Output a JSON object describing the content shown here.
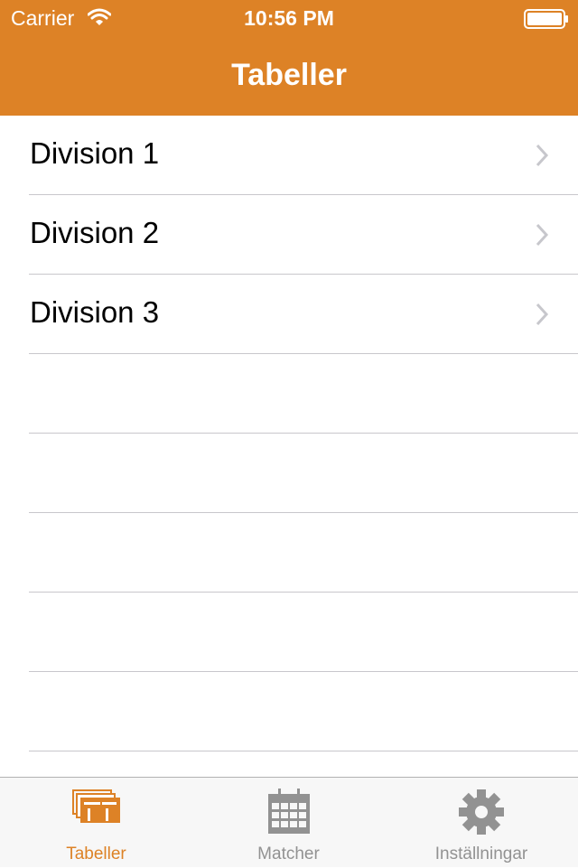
{
  "colors": {
    "accent": "#dd8226",
    "inactive": "#929292",
    "separator": "#c8c7cc"
  },
  "status_bar": {
    "carrier": "Carrier",
    "time": "10:56 PM",
    "wifi_icon": "wifi-icon",
    "battery_icon": "battery-icon"
  },
  "nav": {
    "title": "Tabeller"
  },
  "list": {
    "items": [
      {
        "label": "Division 1",
        "icon": "chevron-right-icon"
      },
      {
        "label": "Division 2",
        "icon": "chevron-right-icon"
      },
      {
        "label": "Division 3",
        "icon": "chevron-right-icon"
      }
    ]
  },
  "tabbar": {
    "items": [
      {
        "label": "Tabeller",
        "icon": "tables-icon",
        "selected": true
      },
      {
        "label": "Matcher",
        "icon": "calendar-icon",
        "selected": false
      },
      {
        "label": "Inställningar",
        "icon": "gear-icon",
        "selected": false
      }
    ]
  }
}
